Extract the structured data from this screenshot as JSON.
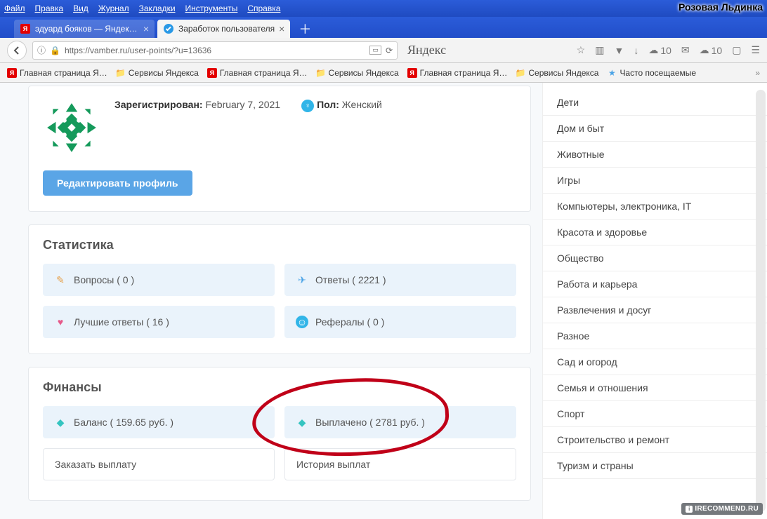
{
  "browser": {
    "menus": [
      "Файл",
      "Правка",
      "Вид",
      "Журнал",
      "Закладки",
      "Инструменты",
      "Справка"
    ],
    "username_badge": "Розовая Льдинка",
    "tabs": [
      {
        "title": "эдуард бояков — Яндекс: н…",
        "active": false,
        "favicon": "yandex"
      },
      {
        "title": "Заработок пользователя",
        "active": true,
        "favicon": "check"
      }
    ],
    "url": "https://vamber.ru/user-points/?u=13636",
    "search_label": "Яндекс",
    "cloud_counts": [
      "10",
      "10"
    ],
    "bookmarks": [
      {
        "label": "Главная страница Я…",
        "icon": "yandex"
      },
      {
        "label": "Сервисы Яндекса",
        "icon": "folder"
      },
      {
        "label": "Главная страница Я…",
        "icon": "yandex"
      },
      {
        "label": "Сервисы Яндекса",
        "icon": "folder"
      },
      {
        "label": "Главная страница Я…",
        "icon": "yandex"
      },
      {
        "label": "Сервисы Яндекса",
        "icon": "folder"
      },
      {
        "label": "Часто посещаемые",
        "icon": "star"
      }
    ]
  },
  "profile": {
    "registered_label": "Зарегистрирован:",
    "registered_value": "February 7, 2021",
    "gender_label": "Пол:",
    "gender_value": "Женский",
    "edit_button": "Редактировать профиль"
  },
  "stats": {
    "heading": "Статистика",
    "questions": "Вопросы ( 0 )",
    "answers": "Ответы ( 2221 )",
    "best": "Лучшие ответы ( 16 )",
    "referrals": "Рефералы ( 0 )"
  },
  "finance": {
    "heading": "Финансы",
    "balance": "Баланс ( 159.65 руб. )",
    "paid": "Выплачено ( 2781 руб. )",
    "order_payout": "Заказать выплату",
    "history": "История выплат"
  },
  "sidebar": {
    "items": [
      "Дети",
      "Дом и быт",
      "Животные",
      "Игры",
      "Компьютеры, электроника, IT",
      "Красота и здоровье",
      "Общество",
      "Работа и карьера",
      "Развлечения и досуг",
      "Разное",
      "Сад и огород",
      "Семья и отношения",
      "Спорт",
      "Строительство и ремонт",
      "Туризм и страны"
    ]
  },
  "watermark": "IRECOMMEND.RU"
}
